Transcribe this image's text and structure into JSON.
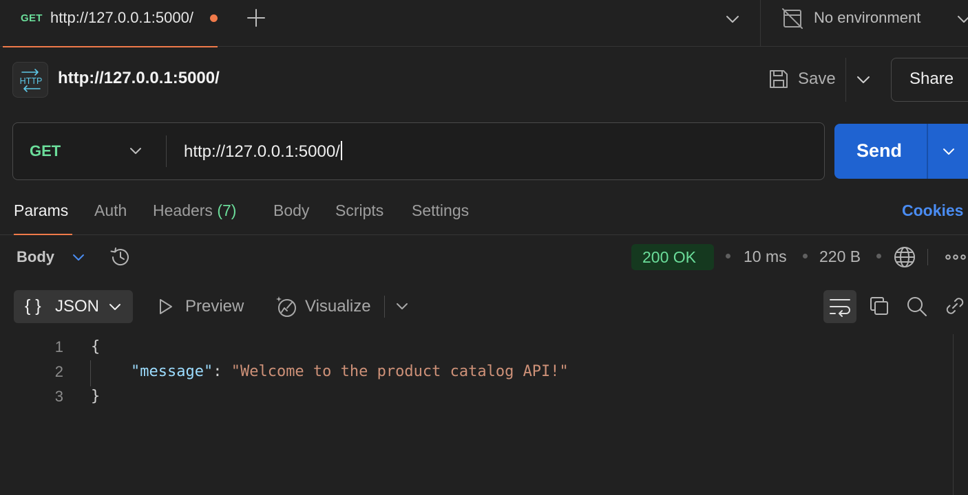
{
  "tabs": [
    {
      "method": "GET",
      "title": "http://127.0.0.1:5000/",
      "unsaved": true,
      "method_color": "#6bdd9a"
    }
  ],
  "environment": {
    "label": "No environment"
  },
  "request": {
    "title": "http://127.0.0.1:5000/",
    "save_label": "Save",
    "share_label": "Share",
    "method": "GET",
    "url": "http://127.0.0.1:5000/",
    "send_label": "Send"
  },
  "request_tabs": [
    {
      "label": "Params",
      "active": true
    },
    {
      "label": "Auth"
    },
    {
      "label": "Headers",
      "count": "(7)"
    },
    {
      "label": "Body"
    },
    {
      "label": "Scripts"
    },
    {
      "label": "Settings"
    }
  ],
  "cookies_label": "Cookies",
  "response": {
    "body_label": "Body",
    "status": "200 OK",
    "time": "10 ms",
    "size": "220 B",
    "format": "JSON",
    "format_glyph": "{ }",
    "preview_label": "Preview",
    "visualize_label": "Visualize",
    "lines": [
      {
        "no": "1",
        "text": "{"
      },
      {
        "no": "2",
        "key": "\"message\"",
        "sep": ": ",
        "value": "\"Welcome to the product catalog API!\""
      },
      {
        "no": "3",
        "text": "}"
      }
    ]
  },
  "colors": {
    "accent": "#f07a4a",
    "method_get": "#6bdd9a",
    "send": "#1f63d1",
    "link": "#4a8cf2",
    "status_ok_bg": "#15391f"
  },
  "icons": [
    "plus-icon",
    "chevron-down-icon",
    "no-environment-icon",
    "http-icon",
    "save-icon",
    "history-icon",
    "globe-icon",
    "more-icon",
    "play-icon",
    "visualize-icon",
    "wrap-icon",
    "copy-icon",
    "search-icon",
    "link-icon"
  ]
}
